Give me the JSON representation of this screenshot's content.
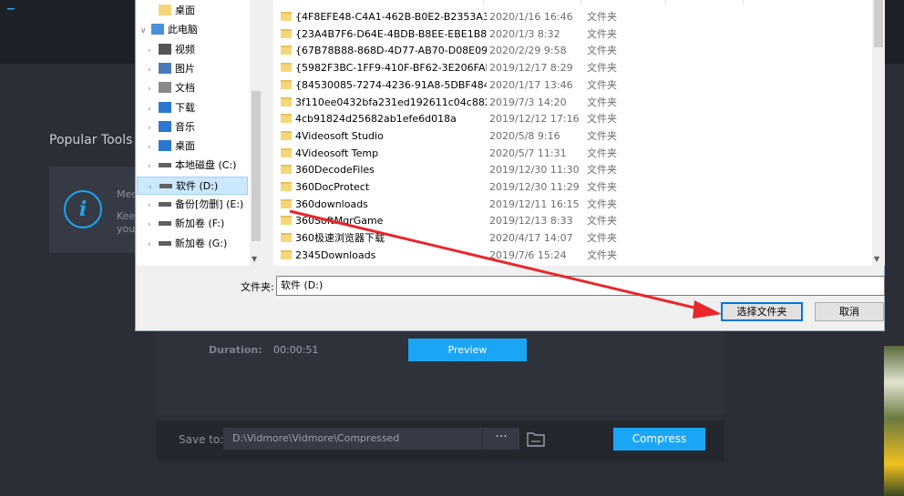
{
  "app": {
    "popular_tools": "Popular Tools",
    "card_line1": "Med",
    "card_line2": "Keep",
    "card_line3": "you",
    "duration_label": "Duration:",
    "duration_value": "00:00:51",
    "preview_label": "Preview",
    "save_to_label": "Save to:",
    "save_path": "D:\\Vidmore\\Vidmore\\Compressed",
    "dots": "···",
    "compress_label": "Compress",
    "accent_color": "#1ba6f5"
  },
  "dialog": {
    "tree": [
      {
        "label": "桌面",
        "icon": "folder-icon",
        "indent": 1,
        "chevron": ""
      },
      {
        "label": "此电脑",
        "icon": "computer-icon",
        "indent": 0,
        "chevron": "∨"
      },
      {
        "label": "视频",
        "icon": "video-icon",
        "indent": 1,
        "chevron": "›"
      },
      {
        "label": "图片",
        "icon": "picture-icon",
        "indent": 1,
        "chevron": "›"
      },
      {
        "label": "文档",
        "icon": "document-icon",
        "indent": 1,
        "chevron": "›"
      },
      {
        "label": "下载",
        "icon": "download-icon",
        "indent": 1,
        "chevron": "›"
      },
      {
        "label": "音乐",
        "icon": "music-icon",
        "indent": 1,
        "chevron": "›"
      },
      {
        "label": "桌面",
        "icon": "desktop-icon",
        "indent": 1,
        "chevron": "›"
      },
      {
        "label": "本地磁盘 (C:)",
        "icon": "drive-icon",
        "indent": 1,
        "chevron": "›"
      },
      {
        "label": "软件 (D:)",
        "icon": "drive-icon",
        "indent": 1,
        "chevron": "›",
        "selected": true
      },
      {
        "label": "备份[勿删] (E:)",
        "icon": "drive-icon",
        "indent": 1,
        "chevron": "›"
      },
      {
        "label": "新加卷 (F:)",
        "icon": "drive-icon",
        "indent": 1,
        "chevron": "›"
      },
      {
        "label": "新加卷 (G:)",
        "icon": "drive-icon",
        "indent": 1,
        "chevron": "›"
      }
    ],
    "files": [
      {
        "name": "{4F8EFE48-C4A1-462B-B0E2-B2353A3...",
        "date": "2020/1/16 16:46",
        "type": "文件夹"
      },
      {
        "name": "{23A4B7F6-D64E-4BDB-B8EE-EBE1B8...",
        "date": "2020/1/3 8:32",
        "type": "文件夹"
      },
      {
        "name": "{67B78B88-868D-4D77-AB70-D08E09...",
        "date": "2020/2/29 9:58",
        "type": "文件夹"
      },
      {
        "name": "{5982F3BC-1FF9-410F-BF62-3E206FAF...",
        "date": "2019/12/17 8:29",
        "type": "文件夹"
      },
      {
        "name": "{84530085-7274-4236-91A8-5DBF484...",
        "date": "2020/1/17 13:46",
        "type": "文件夹"
      },
      {
        "name": "3f110ee0432bfa231ed192611c04c882",
        "date": "2019/7/3 14:20",
        "type": "文件夹"
      },
      {
        "name": "4cb91824d25682ab1efe6d018a",
        "date": "2019/12/12 17:16",
        "type": "文件夹"
      },
      {
        "name": "4Videosoft Studio",
        "date": "2020/5/8 9:16",
        "type": "文件夹"
      },
      {
        "name": "4Videosoft Temp",
        "date": "2020/5/7 11:31",
        "type": "文件夹"
      },
      {
        "name": "360DecodeFiles",
        "date": "2019/12/30 11:30",
        "type": "文件夹"
      },
      {
        "name": "360DocProtect",
        "date": "2019/12/30 11:29",
        "type": "文件夹"
      },
      {
        "name": "360downloads",
        "date": "2019/12/11 16:15",
        "type": "文件夹"
      },
      {
        "name": "360SoftMgrGame",
        "date": "2019/12/13 8:33",
        "type": "文件夹"
      },
      {
        "name": "360极速浏览器下载",
        "date": "2020/4/17 14:07",
        "type": "文件夹"
      },
      {
        "name": "2345Downloads",
        "date": "2019/7/6 15:24",
        "type": "文件夹"
      }
    ],
    "folder_label": "文件夹:",
    "folder_value": "软件 (D:)",
    "select_label": "选择文件夹",
    "cancel_label": "取消"
  }
}
